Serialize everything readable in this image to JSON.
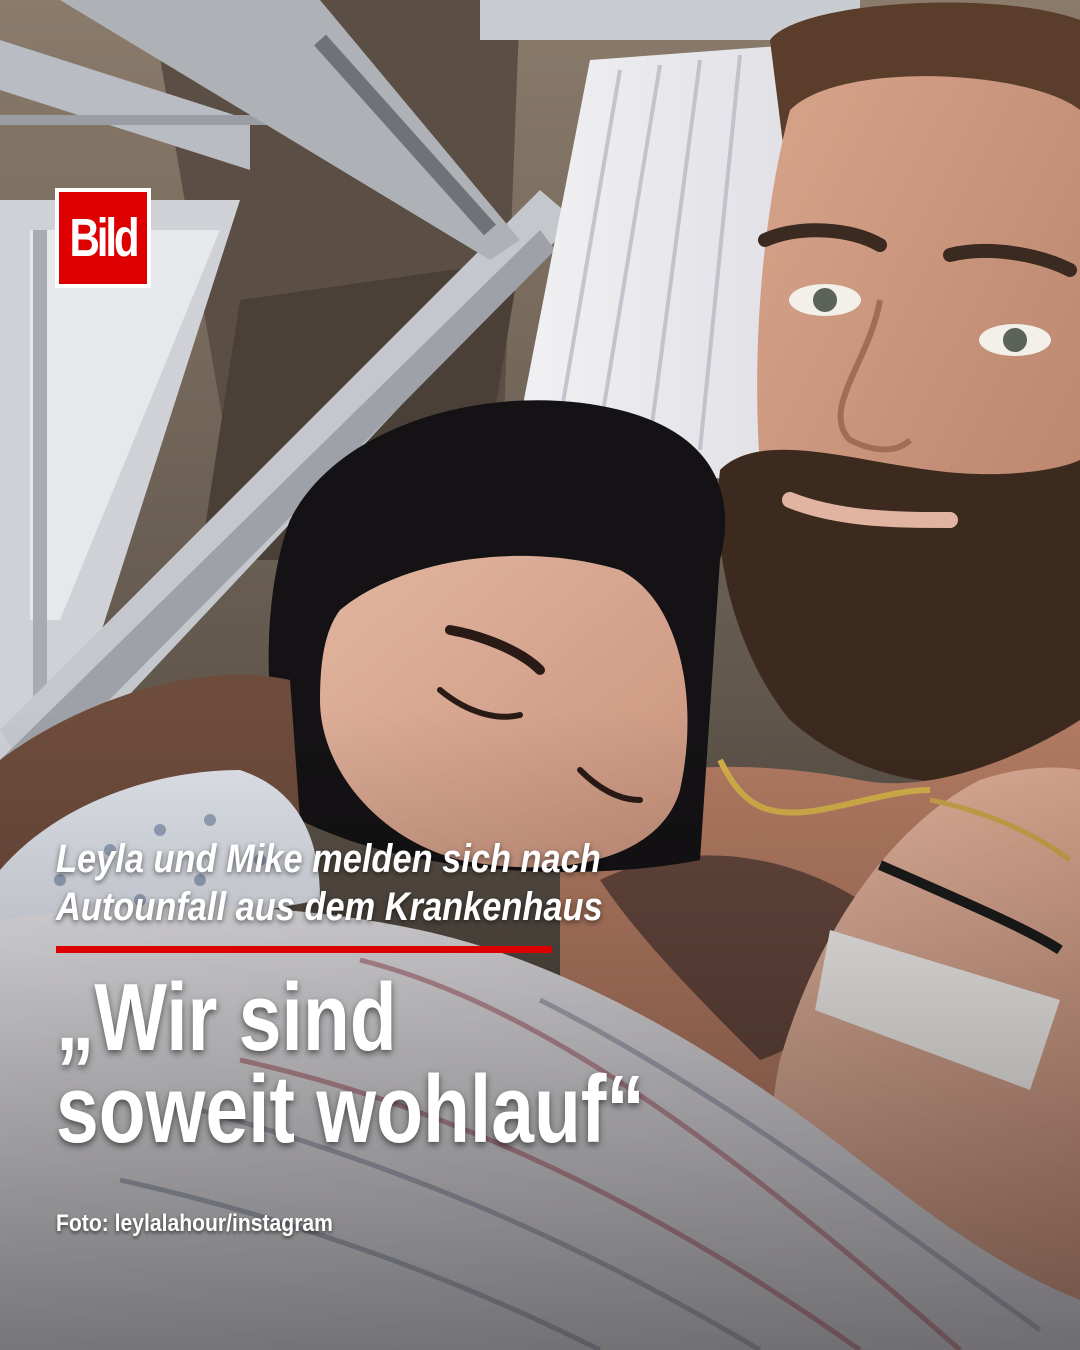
{
  "brand": {
    "logo_text": "Bild",
    "accent_color": "#dd0000"
  },
  "article": {
    "subline_1": "Leyla und Mike melden sich nach",
    "subline_2": "Autounfall aus dem Krankenhaus",
    "headline_1": "„Wir sind",
    "headline_2": "soweit wohlauf“"
  },
  "photo_credit": "Foto: leylalahour/instagram"
}
